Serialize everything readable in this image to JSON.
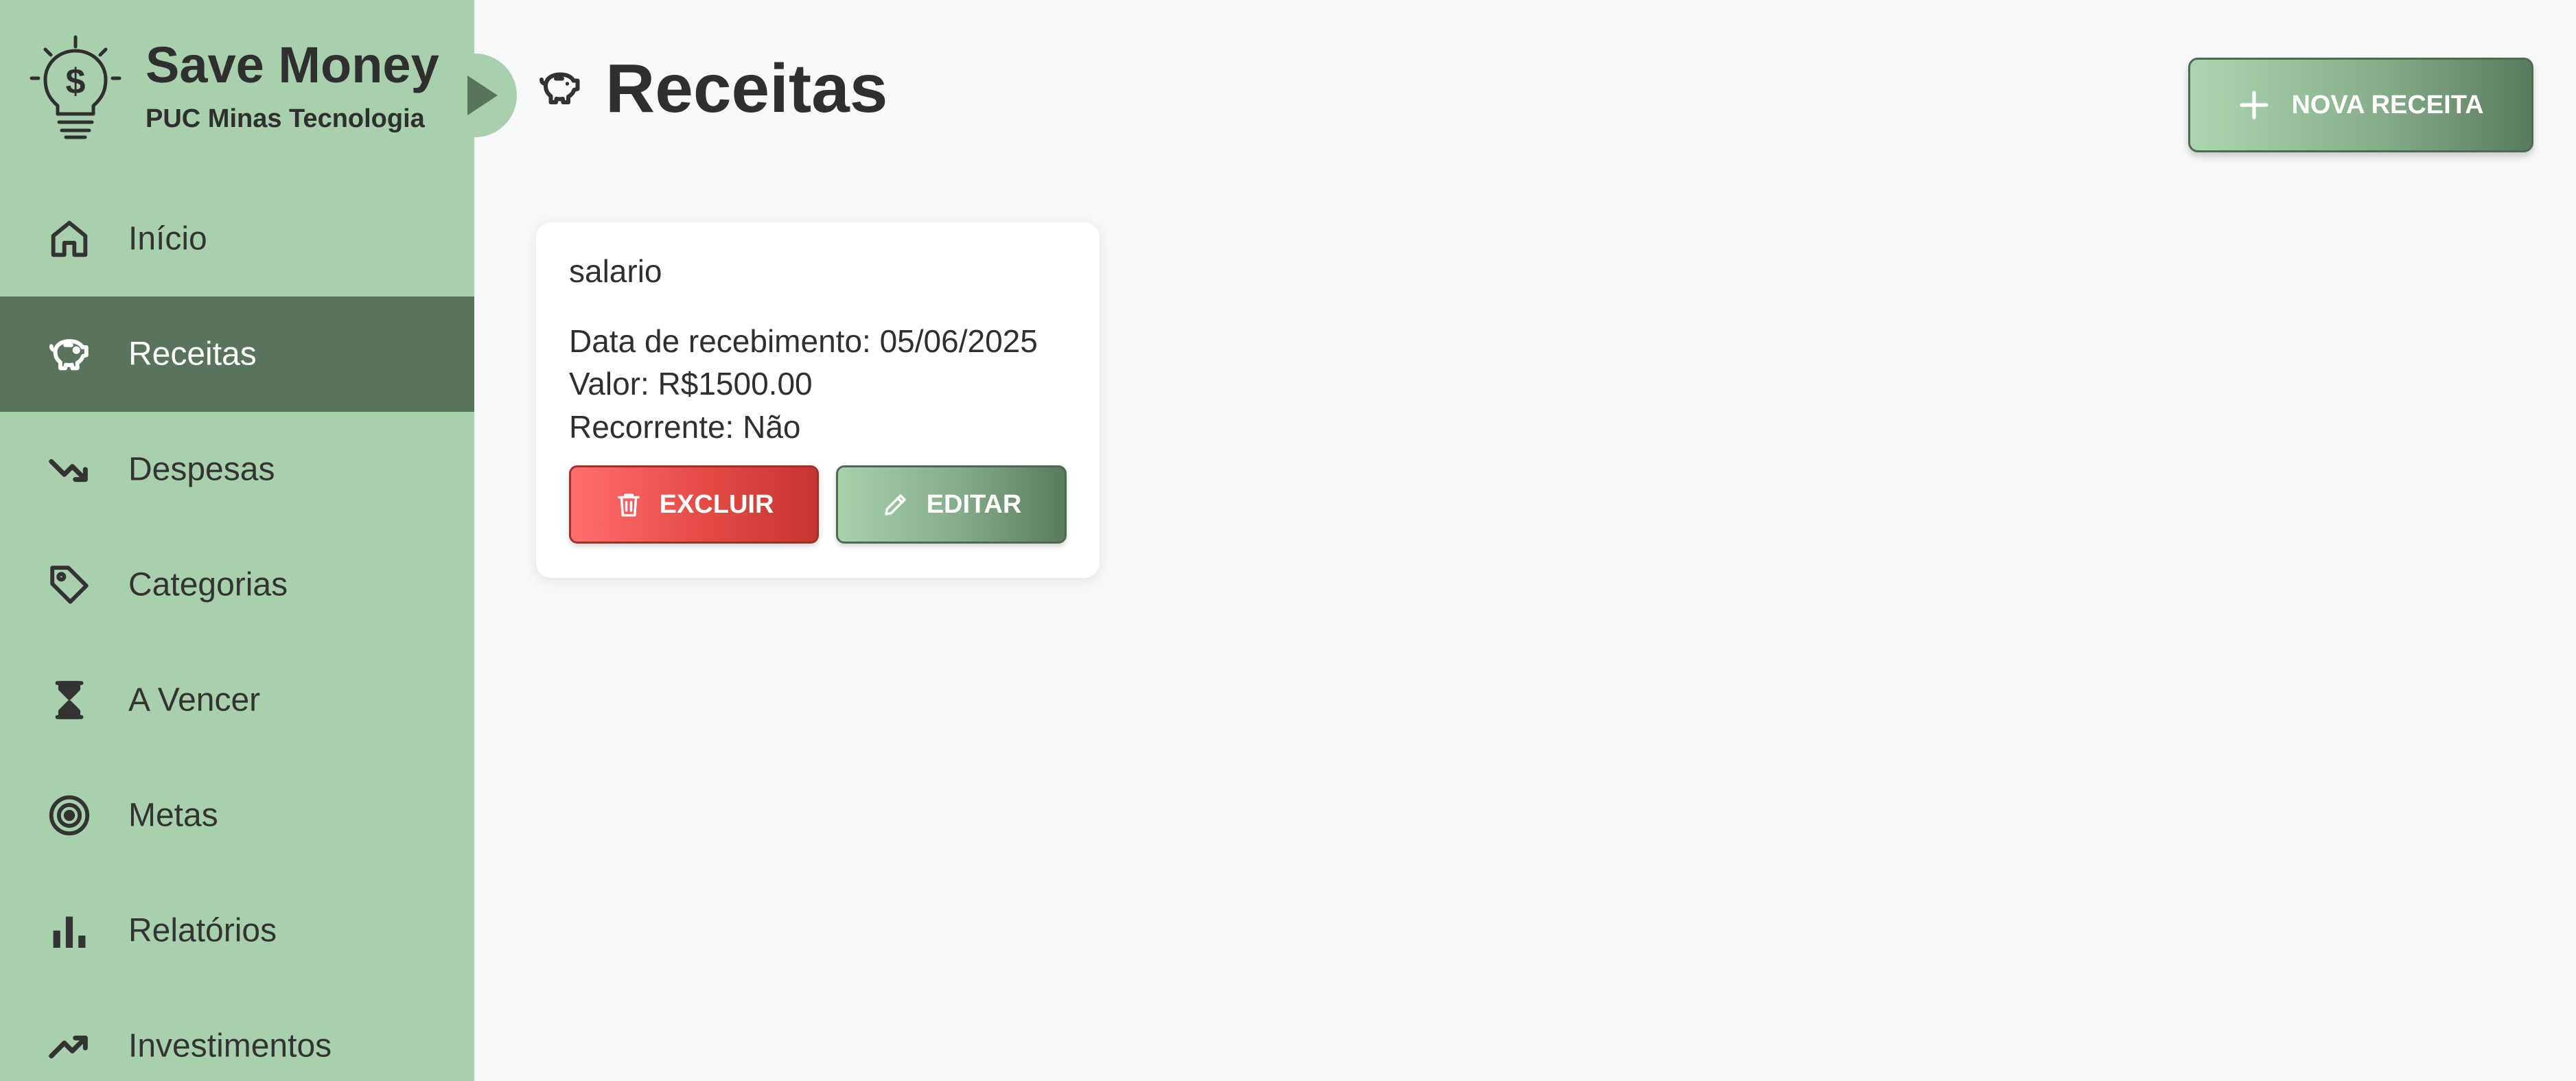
{
  "brand": {
    "title": "Save Money",
    "subtitle": "PUC Minas Tecnologia"
  },
  "sidebar": {
    "items": [
      {
        "label": "Início",
        "icon": "home-icon",
        "active": false
      },
      {
        "label": "Receitas",
        "icon": "piggy-bank-icon",
        "active": true
      },
      {
        "label": "Despesas",
        "icon": "trending-down-icon",
        "active": false
      },
      {
        "label": "Categorias",
        "icon": "tag-icon",
        "active": false
      },
      {
        "label": "A Vencer",
        "icon": "hourglass-icon",
        "active": false
      },
      {
        "label": "Metas",
        "icon": "target-icon",
        "active": false
      },
      {
        "label": "Relatórios",
        "icon": "bar-chart-icon",
        "active": false
      },
      {
        "label": "Investimentos",
        "icon": "trending-up-icon",
        "active": false
      }
    ]
  },
  "header": {
    "title": "Receitas",
    "icon": "piggy-bank-icon",
    "new_button_label": "NOVA RECEITA"
  },
  "receitas": [
    {
      "nome": "salario",
      "data_recebimento": "Data de recebimento: 05/06/2025",
      "valor": "Valor: R$1500.00",
      "recorrente": "Recorrente: Não",
      "delete_label": "EXCLUIR",
      "edit_label": "EDITAR"
    }
  ],
  "colors": {
    "sidebar": "#a8d0ad",
    "active_item": "#5a735c",
    "danger": "#e44a44",
    "primary": "#83ab88",
    "background": "#f7f8fa"
  }
}
